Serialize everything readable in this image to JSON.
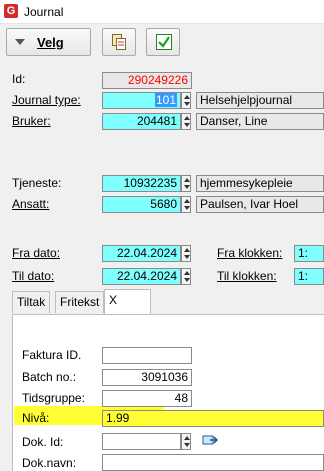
{
  "window": {
    "title": "Journal",
    "app_icon": "G"
  },
  "toolbar": {
    "velg_label": "Velg"
  },
  "form": {
    "id_label": "Id:",
    "id_value": "290249226",
    "journal_type_label": "Journal type:",
    "journal_type_code": "101",
    "journal_type_name": "Helsehjelpjournal",
    "bruker_label": "Bruker:",
    "bruker_code": "204481",
    "bruker_name": "Danser, Line",
    "tjeneste_label": "Tjeneste:",
    "tjeneste_code": "10932235",
    "tjeneste_name": "hjemmesykepleie",
    "ansatt_label": "Ansatt:",
    "ansatt_code": "5680",
    "ansatt_name": "Paulsen, Ivar Hoel",
    "fra_dato_label": "Fra dato:",
    "fra_dato_value": "22.04.2024",
    "til_dato_label": "Til dato:",
    "til_dato_value": "22.04.2024",
    "fra_klokken_label": "Fra klokken:",
    "fra_klokken_value": "1:",
    "til_klokken_label": "Til klokken:",
    "til_klokken_value": "1:"
  },
  "tabs": [
    {
      "label": "Tiltak"
    },
    {
      "label": "Fritekst"
    },
    {
      "label": "X"
    }
  ],
  "panel": {
    "faktura_label": "Faktura ID.",
    "faktura_value": "",
    "batch_label": "Batch no.:",
    "batch_value": "3091036",
    "tidsgruppe_label": "Tidsgruppe:",
    "tidsgruppe_value": "48",
    "niva_label": "Nivå:",
    "niva_value": "1.99",
    "dok_id_label": "Dok. Id:",
    "dok_id_value": "",
    "dok_navn_label": "Dok.navn:",
    "dok_navn_value": ""
  },
  "colors": {
    "required_field": "#80ffff",
    "highlight": "#ffff33",
    "id_text": "#ff0000"
  }
}
